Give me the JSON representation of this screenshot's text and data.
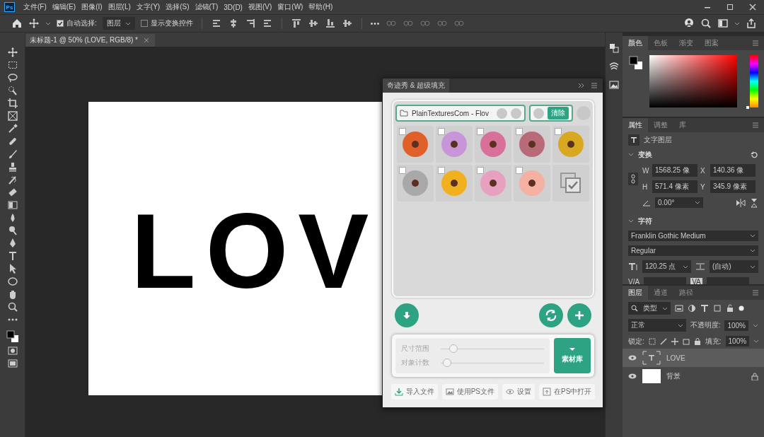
{
  "menu_bar": {
    "logo": "Ps",
    "items": [
      "文件(F)",
      "编辑(E)",
      "图像(I)",
      "图层(L)",
      "文字(Y)",
      "选择(S)",
      "滤镜(T)",
      "3D(D)",
      "视图(V)",
      "窗口(W)",
      "帮助(H)"
    ]
  },
  "options_bar": {
    "auto_select": {
      "label": "自动选择:",
      "checked": true
    },
    "auto_select_target": "图层",
    "show_transform": {
      "label": "显示变换控件",
      "checked": false
    },
    "more": "•••"
  },
  "document_tab": {
    "title": "未标题-1 @ 50% (LOVE, RGB/8) *"
  },
  "canvas": {
    "text": "LOV"
  },
  "plugin": {
    "title": "奇迹秀 & 超级填充",
    "folder": "PlainTexturesCom - Flov",
    "clear_button": "清除",
    "tiles": [
      {
        "kind": "photo",
        "color": "#e0602a",
        "checked": false
      },
      {
        "kind": "photo",
        "color": "#c896d8",
        "checked": false
      },
      {
        "kind": "photo",
        "color": "#d8709a",
        "checked": false
      },
      {
        "kind": "photo",
        "color": "#b86a78",
        "checked": false
      },
      {
        "kind": "photo",
        "color": "#d8a820",
        "checked": false
      },
      {
        "kind": "photo",
        "color": "#a8a8a8",
        "checked": false
      },
      {
        "kind": "photo",
        "color": "#f0b020",
        "checked": false
      },
      {
        "kind": "photo",
        "color": "#e8a0c0",
        "checked": false
      },
      {
        "kind": "photo",
        "color": "#f4b0a0",
        "checked": false
      },
      {
        "kind": "select_all"
      }
    ],
    "sliders": [
      {
        "label": "尺寸范围",
        "level": 0.12
      },
      {
        "label": "对象计数",
        "level": 0.06
      }
    ],
    "library_button": "素材库",
    "footer": [
      "导入文件",
      "使用PS文件",
      "设置",
      "在PS中打开"
    ]
  },
  "color_panel": {
    "hue_slider": {
      "level": 0
    },
    "tabs": [
      {
        "label": "颜色",
        "selected": true
      },
      {
        "label": "色板",
        "selected": false
      },
      {
        "label": "渐变",
        "selected": false
      },
      {
        "label": "图案",
        "selected": false
      }
    ]
  },
  "properties_panel": {
    "tabs": [
      {
        "label": "属性",
        "selected": true
      },
      {
        "label": "调整",
        "selected": false
      },
      {
        "label": "库",
        "selected": false
      }
    ],
    "layer_kind": "文字图层",
    "transform": {
      "title": "变换",
      "fields": [
        {
          "label": "W",
          "value": "1568.25 像"
        },
        {
          "label": "X",
          "value": "140.36 像"
        },
        {
          "label": "H",
          "value": "571.4 像素"
        },
        {
          "label": "Y",
          "value": "345.9 像素"
        }
      ],
      "angle": "0.00°"
    },
    "character": {
      "title": "字符",
      "font": "Franklin Gothic Medium",
      "style": "Regular",
      "size": "120.25 点",
      "leading": "(自动)",
      "kerning_label": "V/A",
      "tracking_label": "VA"
    }
  },
  "layers_panel": {
    "tabs": [
      {
        "label": "图层",
        "selected": true
      },
      {
        "label": "通道",
        "selected": false
      },
      {
        "label": "路径",
        "selected": false
      }
    ],
    "filter": "类型",
    "blend_mode": "正常",
    "opacity_label": "不透明度:",
    "opacity": "100%",
    "lock_label": "锁定:",
    "fill_label": "填充:",
    "fill": "100%",
    "layers": [
      {
        "name": "LOVE",
        "kind": "text",
        "selected": true,
        "visible": true,
        "locked": false
      },
      {
        "name": "背景",
        "kind": "background",
        "selected": false,
        "visible": true,
        "locked": true
      }
    ]
  }
}
